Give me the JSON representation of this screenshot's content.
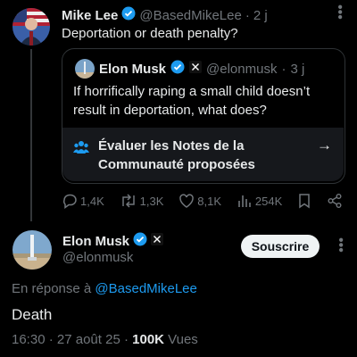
{
  "colors": {
    "accent": "#1d9bf0",
    "verified": "#1d9bf0",
    "muted": "#71767b",
    "text": "#e7e9ea"
  },
  "parent": {
    "author_name": "Mike Lee",
    "handle": "@BasedMikeLee",
    "separator": "·",
    "time": "2 j",
    "text": "Deportation or death penalty?",
    "more_icon": "more-dots-icon"
  },
  "quote": {
    "author_name": "Elon Musk",
    "handle": "@elonmusk",
    "separator": "·",
    "time": "3 j",
    "text": "If horrifically raping a small child doesn’t result in deportation, what does?"
  },
  "notes": {
    "text": "Évaluer les Notes de la Communauté proposées",
    "icon": "community-notes-icon",
    "arrow": "→"
  },
  "actions": {
    "replies": "1,4K",
    "reposts": "1,3K",
    "likes": "8,1K",
    "views": "254K"
  },
  "main": {
    "author_name": "Elon Musk",
    "handle": "@elonmusk",
    "subscribe_label": "Souscrire",
    "reply_prefix": "En réponse à",
    "reply_to": "@BasedMikeLee",
    "text": "Death",
    "time": "16:30",
    "separator": "·",
    "date": "27 août 25",
    "separator2": "·",
    "views_count": "100K",
    "views_label": "Vues"
  }
}
